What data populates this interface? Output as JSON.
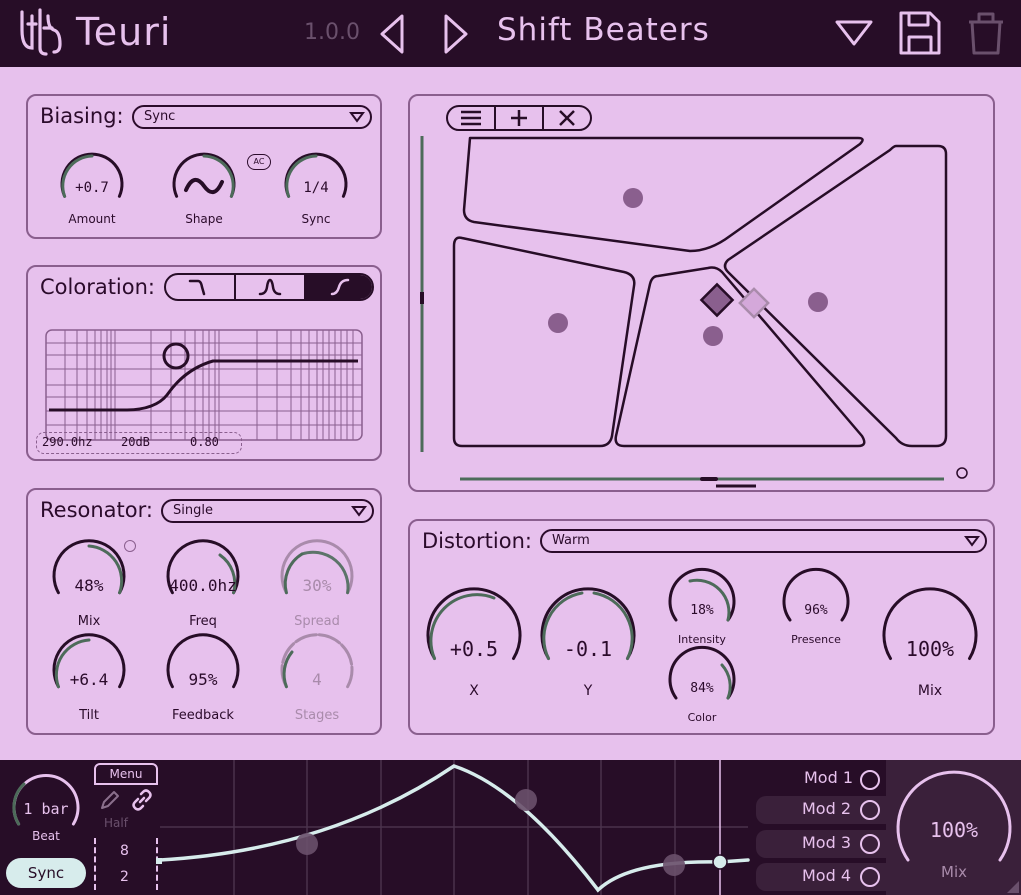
{
  "header": {
    "app_name": "Teuri",
    "version": "1.0.0",
    "preset_name": "Shift Beaters"
  },
  "biasing": {
    "title": "Biasing:",
    "mode": "Sync",
    "knobs": [
      {
        "label": "Amount",
        "value": "+0.7"
      },
      {
        "label": "Shape",
        "value": ""
      },
      {
        "label": "Sync",
        "value": "1/4"
      }
    ],
    "ac_badge": "AC"
  },
  "coloration": {
    "title": "Coloration:",
    "freq": "290.0hz",
    "gain": "20dB",
    "q": "0.80"
  },
  "resonator": {
    "title": "Resonator:",
    "mode": "Single",
    "knobs": [
      {
        "label": "Mix",
        "value": "48%"
      },
      {
        "label": "Freq",
        "value": "400.0hz"
      },
      {
        "label": "Spread",
        "value": "30%"
      },
      {
        "label": "Tilt",
        "value": "+6.4"
      },
      {
        "label": "Feedback",
        "value": "95%"
      },
      {
        "label": "Stages",
        "value": "4"
      }
    ]
  },
  "distortion": {
    "title": "Distortion:",
    "mode": "Warm",
    "knobs": [
      {
        "label": "X",
        "value": "+0.5"
      },
      {
        "label": "Y",
        "value": "-0.1"
      },
      {
        "label": "Intensity",
        "value": "18%"
      },
      {
        "label": "Color",
        "value": "84%"
      },
      {
        "label": "Presence",
        "value": "96%"
      },
      {
        "label": "Mix",
        "value": "100%"
      }
    ]
  },
  "modulator": {
    "rate": "1 bar",
    "rate_label": "Beat",
    "menu": "Menu",
    "half": "Half",
    "grid_top": "8",
    "grid_bottom": "2",
    "sync": "Sync",
    "mods": [
      "Mod 1",
      "Mod 2",
      "Mod 3",
      "Mod 4"
    ],
    "mix_value": "100%",
    "mix_label": "Mix"
  },
  "colors": {
    "dark": "#270d27",
    "panel_bg": "#e7c1ed",
    "knob_green": "#4d6b5a",
    "accent_purple": "#8a5f8e"
  }
}
